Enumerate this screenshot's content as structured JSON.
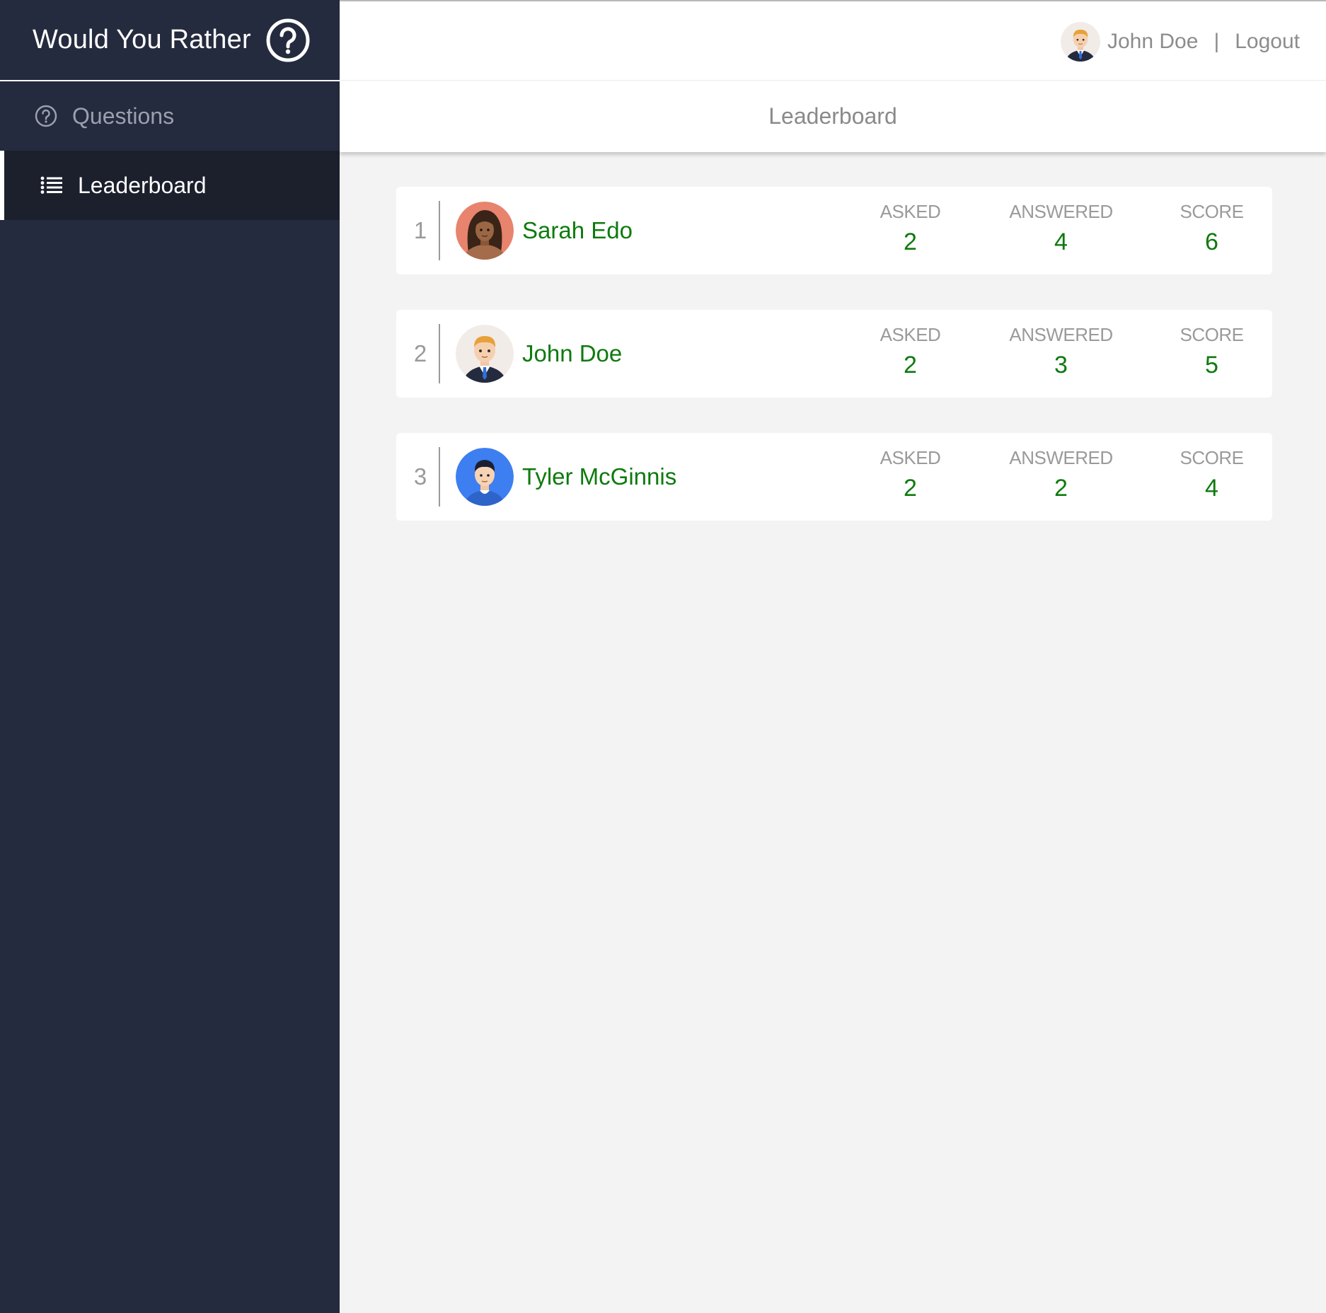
{
  "app": {
    "title": "Would You Rather",
    "brand_icon": "question-circle-icon"
  },
  "nav": {
    "items": [
      {
        "label": "Questions",
        "icon": "question-circle-icon",
        "active": false
      },
      {
        "label": "Leaderboard",
        "icon": "list-icon",
        "active": true
      }
    ]
  },
  "user": {
    "name": "John Doe",
    "separator": "|",
    "logout_label": "Logout"
  },
  "page": {
    "title": "Leaderboard"
  },
  "labels": {
    "asked": "ASKED",
    "answered": "ANSWERED",
    "score": "SCORE"
  },
  "leaderboard": [
    {
      "rank": "1",
      "name": "Sarah Edo",
      "asked": "2",
      "answered": "4",
      "score": "6",
      "avatar": "woman-avatar"
    },
    {
      "rank": "2",
      "name": "John Doe",
      "asked": "2",
      "answered": "3",
      "score": "5",
      "avatar": "businessman-avatar"
    },
    {
      "rank": "3",
      "name": "Tyler McGinnis",
      "asked": "2",
      "answered": "2",
      "score": "4",
      "avatar": "man-avatar"
    }
  ],
  "colors": {
    "sidebar": "#252b3e",
    "sidebar_active": "#1b202c",
    "accent_green": "#0e7a0e",
    "muted_text": "#9a9a9a"
  }
}
